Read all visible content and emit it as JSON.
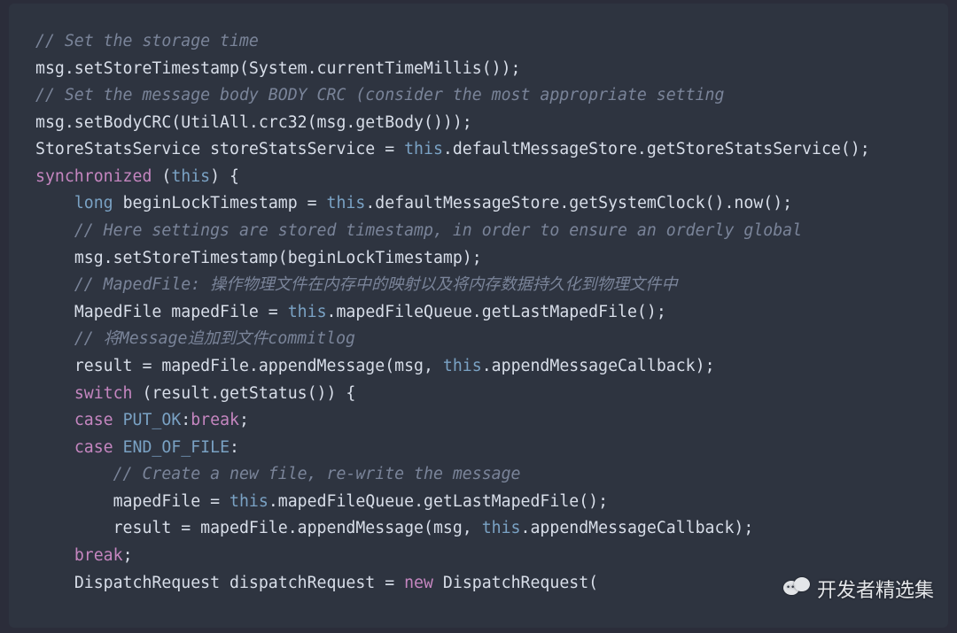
{
  "code": {
    "lines": [
      {
        "indent": 0,
        "tokens": [
          {
            "cls": "cm",
            "t": "// Set the storage time"
          }
        ]
      },
      {
        "indent": 0,
        "tokens": [
          {
            "cls": "str",
            "t": "msg.setStoreTimestamp(System.currentTimeMillis());"
          }
        ]
      },
      {
        "indent": 0,
        "tokens": [
          {
            "cls": "cm",
            "t": "// Set the message body BODY CRC (consider the most appropriate setting"
          }
        ]
      },
      {
        "indent": 0,
        "tokens": [
          {
            "cls": "str",
            "t": "msg.setBodyCRC(UtilAll.crc32(msg.getBody()));"
          }
        ]
      },
      {
        "indent": 0,
        "tokens": [
          {
            "cls": "str",
            "t": "StoreStatsService storeStatsService = "
          },
          {
            "cls": "ty",
            "t": "this"
          },
          {
            "cls": "str",
            "t": ".defaultMessageStore.getStoreStatsService();"
          }
        ]
      },
      {
        "indent": 0,
        "tokens": [
          {
            "cls": "kw",
            "t": "synchronized"
          },
          {
            "cls": "str",
            "t": " ("
          },
          {
            "cls": "ty",
            "t": "this"
          },
          {
            "cls": "str",
            "t": ") {"
          }
        ]
      },
      {
        "indent": 1,
        "tokens": [
          {
            "cls": "ty",
            "t": "long"
          },
          {
            "cls": "str",
            "t": " beginLockTimestamp = "
          },
          {
            "cls": "ty",
            "t": "this"
          },
          {
            "cls": "str",
            "t": ".defaultMessageStore.getSystemClock().now();"
          }
        ]
      },
      {
        "indent": 1,
        "tokens": [
          {
            "cls": "cm",
            "t": "// Here settings are stored timestamp, in order to ensure an orderly global"
          }
        ]
      },
      {
        "indent": 1,
        "tokens": [
          {
            "cls": "str",
            "t": "msg.setStoreTimestamp(beginLockTimestamp);"
          }
        ]
      },
      {
        "indent": 1,
        "tokens": [
          {
            "cls": "cm",
            "t": "// MapedFile: 操作物理文件在内存中的映射以及将内存数据持久化到物理文件中"
          }
        ]
      },
      {
        "indent": 1,
        "tokens": [
          {
            "cls": "str",
            "t": "MapedFile mapedFile = "
          },
          {
            "cls": "ty",
            "t": "this"
          },
          {
            "cls": "str",
            "t": ".mapedFileQueue.getLastMapedFile();"
          }
        ]
      },
      {
        "indent": 1,
        "tokens": [
          {
            "cls": "cm",
            "t": "// 将Message追加到文件commitlog"
          }
        ]
      },
      {
        "indent": 1,
        "tokens": [
          {
            "cls": "str",
            "t": "result = mapedFile.appendMessage(msg, "
          },
          {
            "cls": "ty",
            "t": "this"
          },
          {
            "cls": "str",
            "t": ".appendMessageCallback);"
          }
        ]
      },
      {
        "indent": 1,
        "tokens": [
          {
            "cls": "kw",
            "t": "switch"
          },
          {
            "cls": "str",
            "t": " (result.getStatus()) {"
          }
        ]
      },
      {
        "indent": 1,
        "tokens": [
          {
            "cls": "kw",
            "t": "case"
          },
          {
            "cls": "str",
            "t": " "
          },
          {
            "cls": "const",
            "t": "PUT_OK"
          },
          {
            "cls": "str",
            "t": ":"
          },
          {
            "cls": "kw",
            "t": "break"
          },
          {
            "cls": "str",
            "t": ";"
          }
        ]
      },
      {
        "indent": 1,
        "tokens": [
          {
            "cls": "kw",
            "t": "case"
          },
          {
            "cls": "str",
            "t": " "
          },
          {
            "cls": "const",
            "t": "END_OF_FILE"
          },
          {
            "cls": "str",
            "t": ":"
          }
        ]
      },
      {
        "indent": 2,
        "tokens": [
          {
            "cls": "cm",
            "t": "// Create a new file, re-write the message"
          }
        ]
      },
      {
        "indent": 2,
        "tokens": [
          {
            "cls": "str",
            "t": "mapedFile = "
          },
          {
            "cls": "ty",
            "t": "this"
          },
          {
            "cls": "str",
            "t": ".mapedFileQueue.getLastMapedFile();"
          }
        ]
      },
      {
        "indent": 2,
        "tokens": [
          {
            "cls": "str",
            "t": "result = mapedFile.appendMessage(msg, "
          },
          {
            "cls": "ty",
            "t": "this"
          },
          {
            "cls": "str",
            "t": ".appendMessageCallback);"
          }
        ]
      },
      {
        "indent": 1,
        "tokens": [
          {
            "cls": "kw",
            "t": "break"
          },
          {
            "cls": "str",
            "t": ";"
          }
        ]
      },
      {
        "indent": 1,
        "tokens": [
          {
            "cls": "str",
            "t": "DispatchRequest dispatchRequest = "
          },
          {
            "cls": "kw",
            "t": "new"
          },
          {
            "cls": "str",
            "t": " DispatchRequest("
          }
        ]
      }
    ],
    "indentUnit": "    "
  },
  "watermark": {
    "text": "开发者精选集"
  }
}
